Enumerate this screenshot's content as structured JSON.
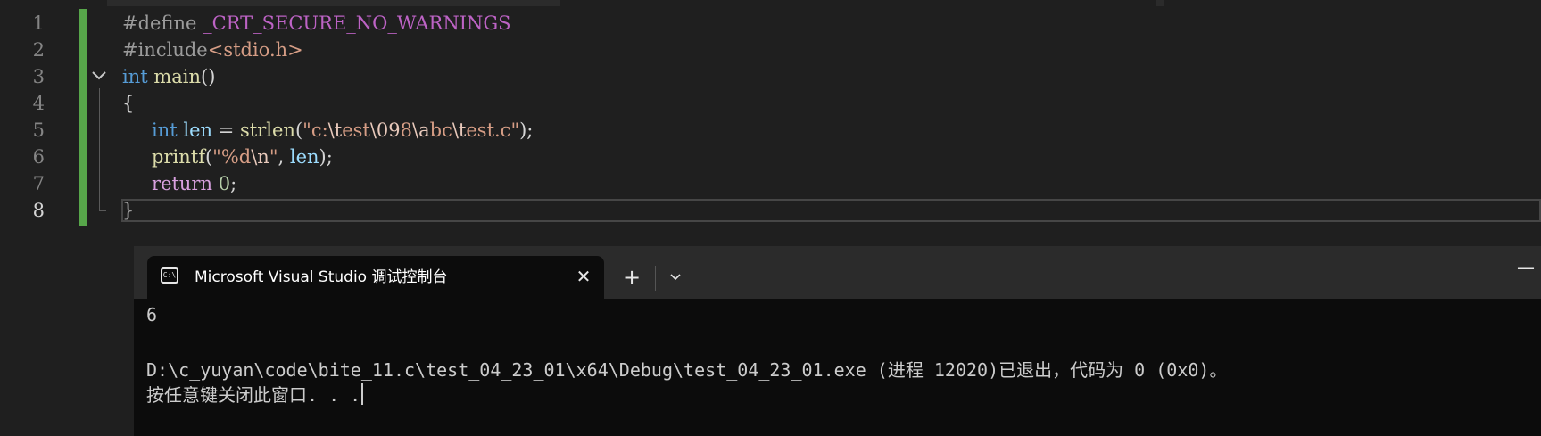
{
  "editor": {
    "line_numbers": [
      "1",
      "2",
      "3",
      "4",
      "5",
      "6",
      "7",
      "8"
    ],
    "line1": {
      "directive": "#define",
      "name": " _CRT_SECURE_NO_WARNINGS"
    },
    "line2": {
      "directive": "#include",
      "header": "<stdio.h>"
    },
    "line3": {
      "type": "int",
      "name": " main",
      "paren": "()"
    },
    "line4": {
      "text": "{"
    },
    "line5": {
      "indent": "   ",
      "type": "int",
      "space": " ",
      "var": "len",
      "assign": " = ",
      "fn": "strlen",
      "open": "(",
      "str_a": "\"c:",
      "esc_a": "\\t",
      "str_b": "est",
      "esc_b": "\\09",
      "str_c": "8",
      "esc_c": "\\a",
      "str_d": "bc",
      "esc_d": "\\t",
      "str_e": "est.c\"",
      "close": ");"
    },
    "line6": {
      "indent": "   ",
      "fn": "printf",
      "open": "(",
      "str_a": "\"%d",
      "esc_a": "\\n",
      "str_b": "\"",
      "comma": ", ",
      "var": "len",
      "close": ");"
    },
    "line7": {
      "indent": "   ",
      "kw": "return",
      "space": " ",
      "num": "0",
      "semi": ";"
    },
    "line8": {
      "text": "}"
    },
    "fold_icon": "chevron-down-icon"
  },
  "terminal": {
    "tab_title": "Microsoft Visual Studio 调试控制台",
    "tab_icon": "console-icon",
    "tab_icon_text": "C:\\",
    "close_glyph": "✕",
    "newtab_glyph": "+",
    "dropdown_glyph": "⌄",
    "minimize_glyph": "—",
    "output": [
      "6",
      "",
      "D:\\c_yuyan\\code\\bite_11.c\\test_04_23_01\\x64\\Debug\\test_04_23_01.exe (进程 12020)已退出，代码为 0 (0x0)。",
      "按任意键关闭此窗口. . ."
    ]
  },
  "colors": {
    "editor_bg": "#1f1f1f",
    "keyword": "#569cd6",
    "string": "#d69d85",
    "function": "#dcdcaa",
    "variable": "#9cdcfe",
    "number": "#b5cea8",
    "change_bar": "#57a64a",
    "terminal_bg": "#0c0c0c"
  }
}
